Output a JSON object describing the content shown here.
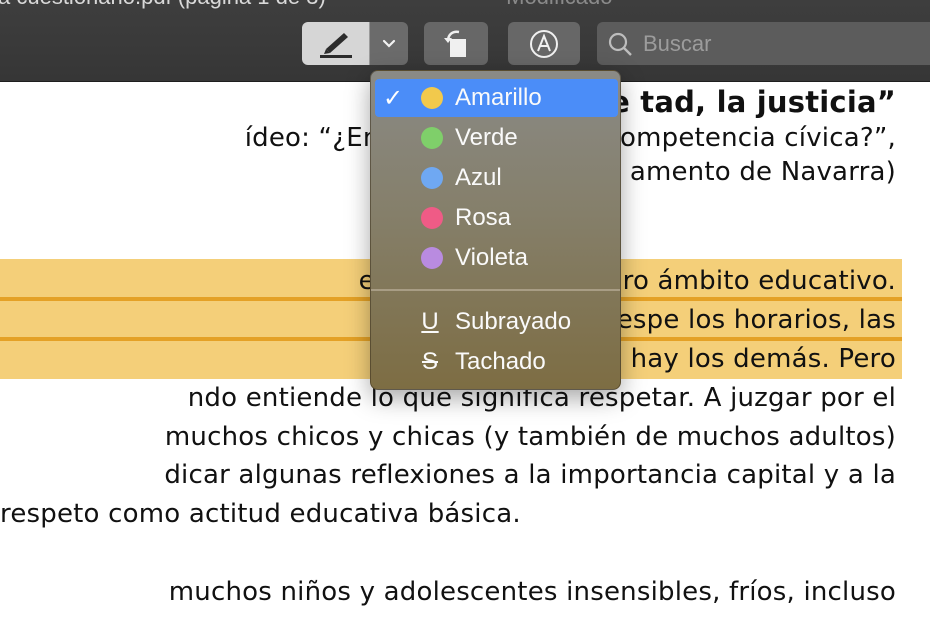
{
  "window": {
    "title": "a cuestionario.pdf (página 1 de 3)",
    "edited": "— Modificado"
  },
  "toolbar": {
    "highlight_icon": "highlighter-icon",
    "dropdown_icon": "chevron-down-icon",
    "rotate_icon": "rotate-left-icon",
    "markup_icon": "markup-pen-icon",
    "search_placeholder": "Buscar"
  },
  "document": {
    "title": "el re                              tad, la justicia”",
    "lines": [
      "ídeo: “¿En qué consiste el a                  ompetencia cívica?”,",
      "amento de Navarra)",
      "es una de las más pro                  ámbito educativo.",
      "cía que hay que respe                  los horarios, las",
      "y sobre todo, que hay                  los demás. Pero",
      "ndo entiende lo que significa respetar. A juzgar por el",
      "muchos chicos y chicas (y también de muchos adultos)",
      "dicar algunas reflexiones a la importancia capital y a la",
      "respeto como actitud educativa básica.",
      "muchos niños y adolescentes insensibles, fríos, incluso"
    ],
    "highlight_color": "#f4cf79",
    "underline_color": "#e4a126"
  },
  "menu": {
    "colors": [
      {
        "label": "Amarillo",
        "color": "#f2c94c",
        "selected": true
      },
      {
        "label": "Verde",
        "color": "#7fcf6a",
        "selected": false
      },
      {
        "label": "Azul",
        "color": "#6fa8f2",
        "selected": false
      },
      {
        "label": "Rosa",
        "color": "#ef5b86",
        "selected": false
      },
      {
        "label": "Violeta",
        "color": "#b98be0",
        "selected": false
      }
    ],
    "check": "✓",
    "styles": [
      {
        "label": "Subrayado",
        "symbol": "U"
      },
      {
        "label": "Tachado",
        "symbol": "S"
      }
    ],
    "selected_bg": "#4b8df8"
  }
}
